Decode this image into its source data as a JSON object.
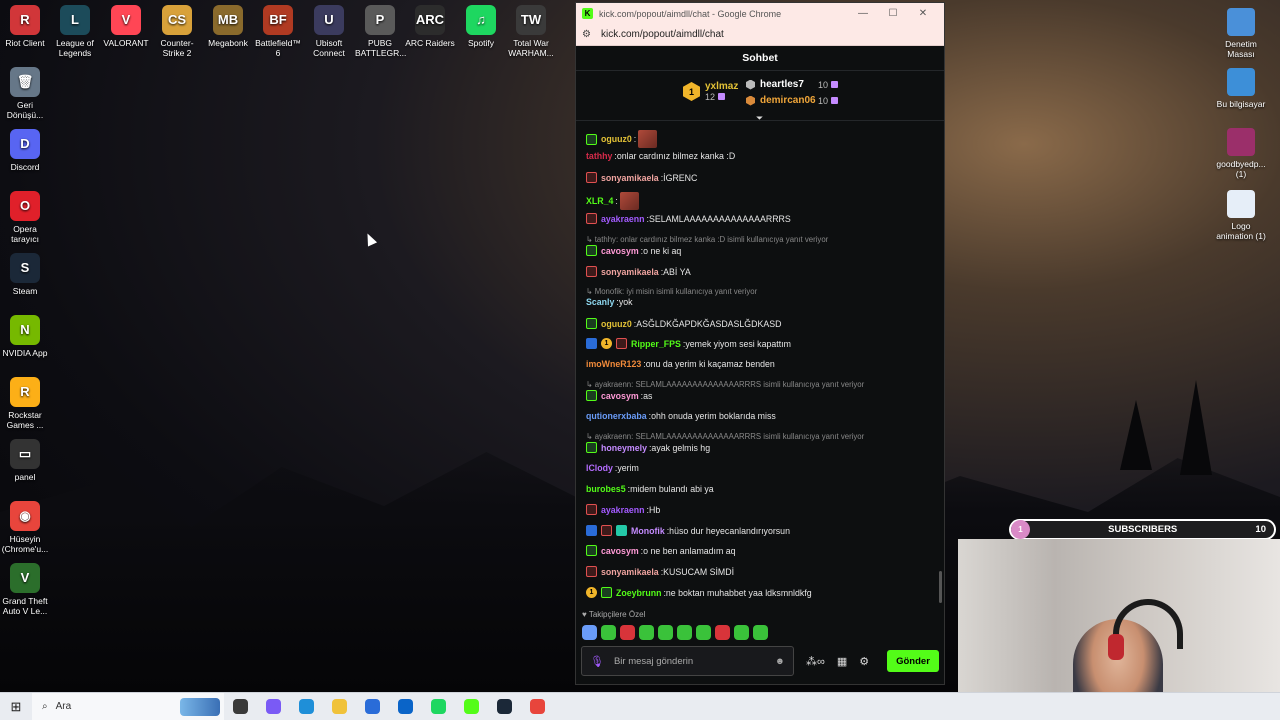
{
  "desktop_left": [
    {
      "label": "Riot Client",
      "icon": "riot-client-icon",
      "color": "#d13639",
      "glyph": "R"
    },
    {
      "label": "League of Legends",
      "icon": "league-of-legends-icon",
      "color": "#1c4b5a",
      "glyph": "L"
    },
    {
      "label": "VALORANT",
      "icon": "valorant-icon",
      "color": "#ff4655",
      "glyph": "V"
    },
    {
      "label": "Counter-Strike 2",
      "icon": "cs2-icon",
      "color": "#d8a13a",
      "glyph": "CS"
    },
    {
      "label": "Megabonk",
      "icon": "megabonk-icon",
      "color": "#8a6a2c",
      "glyph": "MB"
    },
    {
      "label": "Battlefield™ 6",
      "icon": "battlefield-icon",
      "color": "#b03a22",
      "glyph": "BF"
    },
    {
      "label": "Ubisoft Connect",
      "icon": "ubisoft-icon",
      "color": "#3b3b5e",
      "glyph": "U"
    },
    {
      "label": "PUBG BATTLEGR...",
      "icon": "pubg-icon",
      "color": "#5a5a5a",
      "glyph": "P"
    },
    {
      "label": "ARC Raiders",
      "icon": "arc-raiders-icon",
      "color": "#2c2c2c",
      "glyph": "ARC"
    },
    {
      "label": "Spotify",
      "icon": "spotify-icon",
      "color": "#1ed760",
      "glyph": "♫"
    },
    {
      "label": "Total War WARHAM...",
      "icon": "total-war-icon",
      "color": "#3a3a3a",
      "glyph": "TW"
    },
    {
      "label": "Geri Dönüşü...",
      "icon": "recycle-bin-icon",
      "color": "#667788",
      "glyph": "🗑"
    },
    {
      "label": "Discord",
      "icon": "discord-icon",
      "color": "#5865f2",
      "glyph": "D"
    },
    {
      "label": "Opera tarayıcı",
      "icon": "opera-icon",
      "color": "#e0202a",
      "glyph": "O"
    },
    {
      "label": "Steam",
      "icon": "steam-icon",
      "color": "#1b2838",
      "glyph": "S"
    },
    {
      "label": "NVIDIA App",
      "icon": "nvidia-icon",
      "color": "#76b900",
      "glyph": "N"
    },
    {
      "label": "Rockstar Games ...",
      "icon": "rockstar-icon",
      "color": "#fcaf17",
      "glyph": "R"
    },
    {
      "label": "panel",
      "icon": "panel-icon",
      "color": "#333333",
      "glyph": "▭"
    },
    {
      "label": "Hüseyin (Chrome'u...",
      "icon": "chrome-icon",
      "color": "#e8453c",
      "glyph": "◉"
    },
    {
      "label": "Grand Theft Auto V Le...",
      "icon": "gta-icon",
      "color": "#2b6e2b",
      "glyph": "V"
    }
  ],
  "desktop_right": [
    {
      "label": "Denetim Masası",
      "icon": "control-panel-icon",
      "color": "#4a90d9"
    },
    {
      "label": "Bu bilgisayar",
      "icon": "this-pc-icon",
      "color": "#3d8fd8"
    },
    {
      "label": "goodbyedp... (1)",
      "icon": "winrar-icon",
      "color": "#9b2f6a"
    },
    {
      "label": "Logo animation (1)",
      "icon": "video-file-icon",
      "color": "#e6eef8"
    }
  ],
  "window": {
    "title": "kick.com/popout/aimdll/chat - Google Chrome",
    "url": "kick.com/popout/aimdll/chat",
    "minimize": "—",
    "maximize": "☐",
    "close": "✕"
  },
  "chat": {
    "header": "Sohbet",
    "leaderboard": {
      "first": {
        "rank": "1",
        "name": "yxlmaz",
        "count": "12"
      },
      "second": {
        "name": "heartles7",
        "count": "10",
        "color": "#ffffff",
        "hex": "#bbbbbb"
      },
      "third": {
        "name": "demircan06",
        "count": "10",
        "color": "#f0a63a",
        "hex": "#d98a3a"
      }
    },
    "messages": [
      {
        "type": "msg",
        "badges": [
          "green"
        ],
        "user": "oguuz0",
        "color": "#e3c236",
        "text": "",
        "emote": true
      },
      {
        "type": "msg",
        "badges": [],
        "user": "tathhy",
        "color": "#d62b4a",
        "text": "onlar cardınız bilmez kanka :D"
      },
      {
        "type": "msg",
        "badges": [
          "red"
        ],
        "user": "sonyamikaela",
        "color": "#f0a4a0",
        "text": "İGRENC"
      },
      {
        "type": "msg",
        "badges": [],
        "user": "XLR_4",
        "color": "#53fc18",
        "text": "",
        "emote": true
      },
      {
        "type": "msg",
        "badges": [
          "red"
        ],
        "user": "ayakraenn",
        "color": "#a35bff",
        "text": "SELAMLAAAAAAAAAAAAAARRRS"
      },
      {
        "type": "reply",
        "text": "tathhy: onlar cardınız bilmez kanka :D isimli kullanıcıya yanıt veriyor"
      },
      {
        "type": "msg",
        "badges": [
          "green"
        ],
        "user": "cavosym",
        "color": "#ff9ad6",
        "text": "o ne ki aq"
      },
      {
        "type": "msg",
        "badges": [
          "red"
        ],
        "user": "sonyamikaela",
        "color": "#f0a4a0",
        "text": "ABİ YA"
      },
      {
        "type": "reply",
        "text": "Monofik: iyi misin isimli kullanıcıya yanıt veriyor"
      },
      {
        "type": "msg",
        "badges": [],
        "user": "Scanly",
        "color": "#8ed8f0",
        "text": "yok"
      },
      {
        "type": "msg",
        "badges": [
          "green"
        ],
        "user": "oguuz0",
        "color": "#e3c236",
        "text": "ASĞLDKĞAPDKĞASDASLĞDKASD"
      },
      {
        "type": "msg",
        "badges": [
          "blue",
          "gold",
          "red"
        ],
        "user": "Ripper_FPS",
        "color": "#53fc18",
        "text": "yemek yiyom sesi kapattım"
      },
      {
        "type": "msg",
        "badges": [],
        "user": "imoWneR123",
        "color": "#f08a3a",
        "text": "onu da yerim ki kaçamaz benden"
      },
      {
        "type": "reply",
        "text": "ayakraenn: SELAMLAAAAAAAAAAAAAARRRS isimli kullanıcıya yanıt veriyor"
      },
      {
        "type": "msg",
        "badges": [
          "green"
        ],
        "user": "cavosym",
        "color": "#ff9ad6",
        "text": "as"
      },
      {
        "type": "msg",
        "badges": [],
        "user": "qutionerxbaba",
        "color": "#6a9cf8",
        "text": "ohh onuda yerim boklarıda miss"
      },
      {
        "type": "reply",
        "text": "ayakraenn: SELAMLAAAAAAAAAAAAAARRRS isimli kullanıcıya yanıt veriyor"
      },
      {
        "type": "msg",
        "badges": [
          "green"
        ],
        "user": "honeymely",
        "color": "#c48bff",
        "text": "ayak gelmis hg"
      },
      {
        "type": "msg",
        "badges": [],
        "user": "lClody",
        "color": "#b46cff",
        "text": "yerim"
      },
      {
        "type": "msg",
        "badges": [],
        "user": "burobes5",
        "color": "#53fc18",
        "text": "midem bulandı abi ya"
      },
      {
        "type": "msg",
        "badges": [
          "red"
        ],
        "user": "ayakraenn",
        "color": "#a35bff",
        "text": "Hb"
      },
      {
        "type": "msg",
        "badges": [
          "blue",
          "red",
          "teal"
        ],
        "user": "Monofik",
        "color": "#c48bff",
        "text": "hüso dur heyecanlandırıyorsun"
      },
      {
        "type": "msg",
        "badges": [
          "green"
        ],
        "user": "cavosym",
        "color": "#ff9ad6",
        "text": "o ne ben anlamadım aq"
      },
      {
        "type": "msg",
        "badges": [
          "red"
        ],
        "user": "sonyamikaela",
        "color": "#f0a4a0",
        "text": "KUSUCAM SİMDİ"
      },
      {
        "type": "msg",
        "badges": [
          "gold",
          "green"
        ],
        "user": "Zoeybrunn",
        "color": "#53fc18",
        "text": "ne boktan muhabbet yaa ldksmnldkfg"
      }
    ],
    "followers_only": "Takipçilere Özel",
    "input_placeholder": "Bir mesaj gönderin",
    "send_label": "Gönder"
  },
  "overlay": {
    "level": "1",
    "label": "SUBSCRIBERS",
    "count": "10"
  },
  "taskbar": {
    "search_label": "Ara",
    "apps": [
      {
        "icon": "task-view-icon",
        "color": "#3a3a3a"
      },
      {
        "icon": "copilot-icon",
        "color": "#7a5af5"
      },
      {
        "icon": "edge-icon",
        "color": "#1f8fd8"
      },
      {
        "icon": "file-explorer-icon",
        "color": "#f0c23a"
      },
      {
        "icon": "store-icon",
        "color": "#2a6cd8"
      },
      {
        "icon": "outlook-icon",
        "color": "#0a64c8"
      },
      {
        "icon": "spotify-icon",
        "color": "#1ed760"
      },
      {
        "icon": "kick-icon",
        "color": "#53fc18"
      },
      {
        "icon": "steam-tray-icon",
        "color": "#1b2838"
      },
      {
        "icon": "chrome-icon",
        "color": "#e8453c"
      }
    ]
  }
}
